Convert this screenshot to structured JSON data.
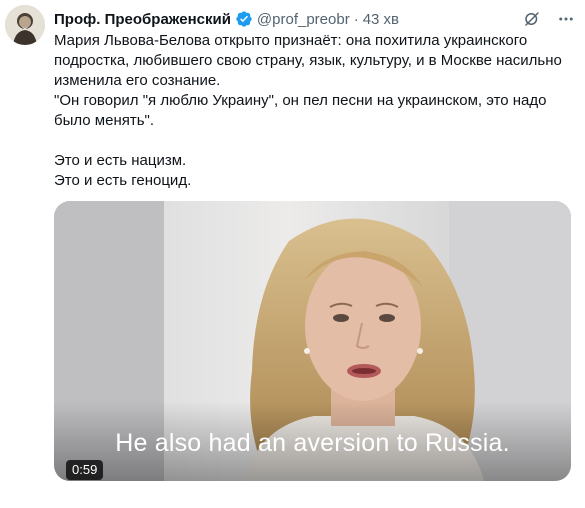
{
  "author": {
    "name": "Проф. Преображенский",
    "handle": "@prof_preobr",
    "separator": "·",
    "time": "43 хв"
  },
  "tweet": {
    "line1": "Мария Львова-Белова открыто признаёт: она похитила украинского подростка, любившего свою страну, язык, культуру, и в Москве насильно изменила его сознание.",
    "line2": "\"Он говорил \"я люблю Украину\", он пел песни на украинском, это надо было менять\".",
    "line3": "Это и есть нацизм.",
    "line4": "Это и есть геноцид."
  },
  "media": {
    "subtitle": "He also had an aversion to Russia.",
    "duration": "0:59"
  },
  "icons": {
    "verified": "verified-badge-icon",
    "grok": "grok-icon",
    "more": "more-icon"
  },
  "colors": {
    "verified": "#1d9bf0",
    "secondary_text": "#536471"
  }
}
